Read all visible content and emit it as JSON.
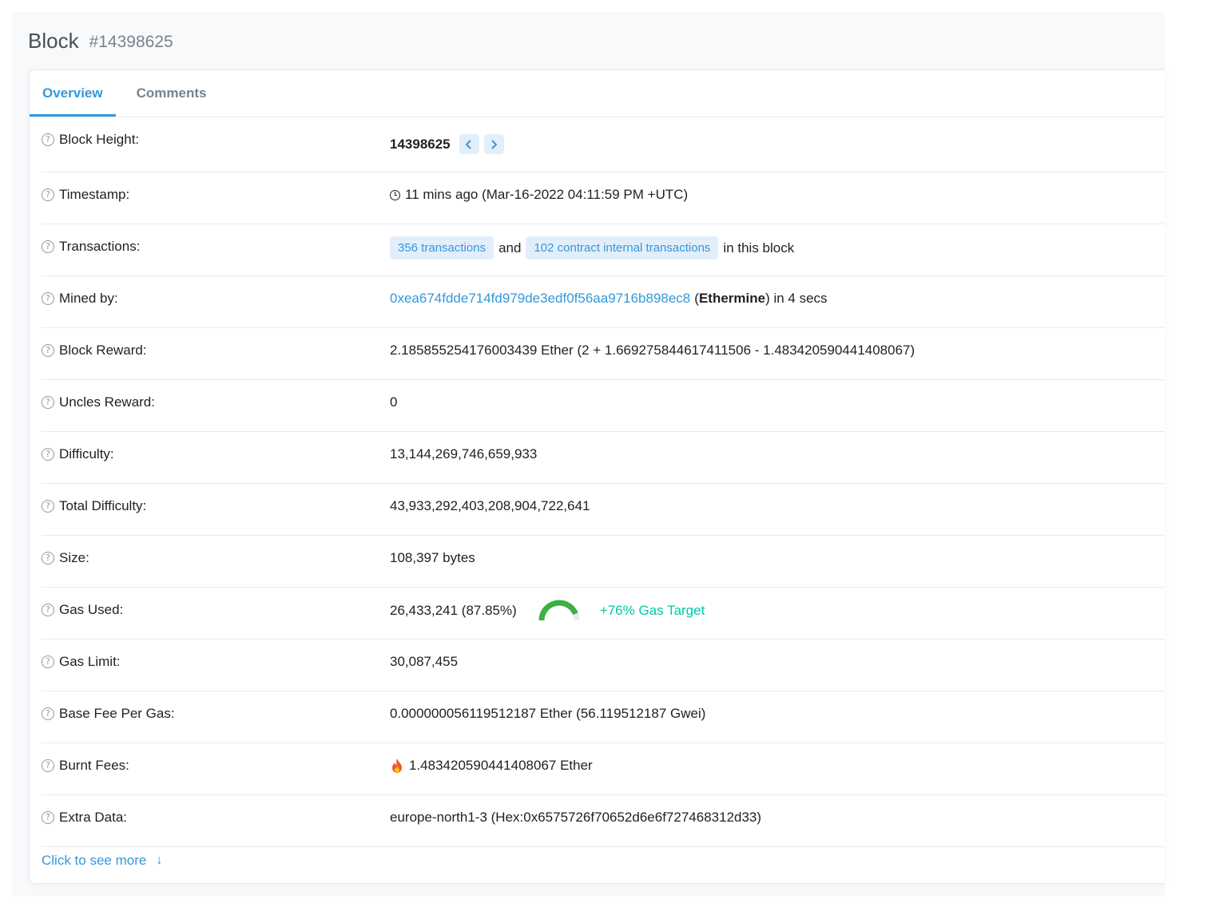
{
  "header": {
    "title": "Block",
    "block_number": "#14398625"
  },
  "tabs": {
    "overview": "Overview",
    "comments": "Comments"
  },
  "rows": {
    "block_height": {
      "label": "Block Height:",
      "value": "14398625",
      "prev_icon": "chevron-left-icon",
      "next_icon": "chevron-right-icon"
    },
    "timestamp": {
      "label": "Timestamp:",
      "value": "11 mins ago (Mar-16-2022 04:11:59 PM +UTC)"
    },
    "transactions": {
      "label": "Transactions:",
      "tx_link": "356 transactions",
      "and_text": "and",
      "internal_link": "102 contract internal transactions",
      "suffix": "in this block"
    },
    "mined_by": {
      "label": "Mined by:",
      "address": "0xea674fdde714fd979de3edf0f56aa9716b898ec8",
      "paren_open": "(",
      "name": "Ethermine",
      "suffix": ") in 4 secs"
    },
    "block_reward": {
      "label": "Block Reward:",
      "value": "2.185855254176003439 Ether (2 + 1.669275844617411506 - 1.483420590441408067)"
    },
    "uncles_reward": {
      "label": "Uncles Reward:",
      "value": "0"
    },
    "difficulty": {
      "label": "Difficulty:",
      "value": "13,144,269,746,659,933"
    },
    "total_difficulty": {
      "label": "Total Difficulty:",
      "value": "43,933,292,403,208,904,722,641"
    },
    "size": {
      "label": "Size:",
      "value": "108,397 bytes"
    },
    "gas_used": {
      "label": "Gas Used:",
      "value": "26,433,241 (87.85%)",
      "gauge_fraction": 0.8785,
      "gauge_color": "#3cb043",
      "target_text": "+76% Gas Target"
    },
    "gas_limit": {
      "label": "Gas Limit:",
      "value": "30,087,455"
    },
    "base_fee": {
      "label": "Base Fee Per Gas:",
      "value": "0.000000056119512187 Ether (56.119512187 Gwei)"
    },
    "burnt_fees": {
      "label": "Burnt Fees:",
      "value": "1.483420590441408067 Ether",
      "icon": "fire-icon"
    },
    "extra_data": {
      "label": "Extra Data:",
      "value": "europe-north1-3 (Hex:0x6575726f70652d6e6f727468312d33)"
    }
  },
  "more": {
    "label": "Click to see more",
    "icon": "arrow-down-icon"
  },
  "colors": {
    "accent": "#3498db",
    "green": "#00c9a7",
    "pill_bg": "#e3eefb"
  }
}
